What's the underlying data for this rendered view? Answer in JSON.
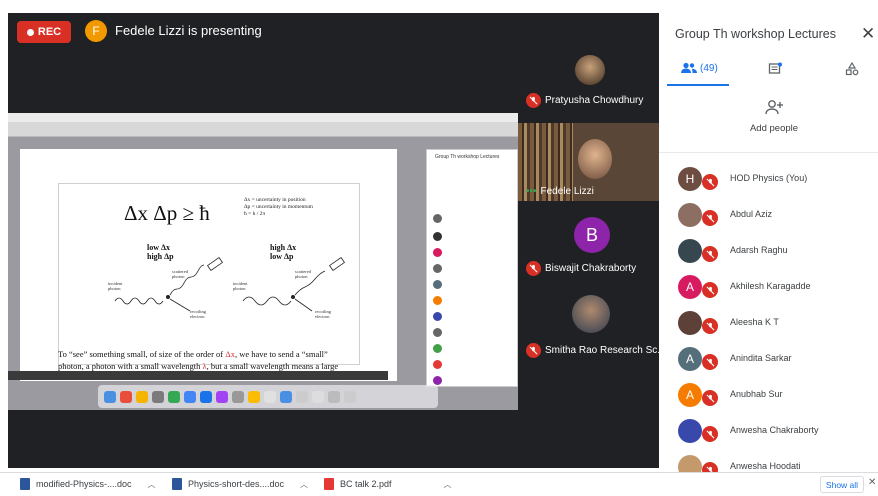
{
  "recording": {
    "label": "REC"
  },
  "presenter": {
    "initial": "F",
    "text": "Fedele Lizzi is presenting"
  },
  "slide": {
    "formula": "Δx Δp  ≥  ħ",
    "defs": [
      "Δx = uncertainty in position",
      "Δp = uncertainty in momentum",
      "ħ = h / 2π"
    ],
    "left_label": [
      "low Δx",
      "high Δp"
    ],
    "right_label": [
      "high Δx",
      "low Δp"
    ],
    "incident_photon": [
      "incident",
      "photon"
    ],
    "scattered_photon": [
      "scattered",
      "photon"
    ],
    "recoiling_electron": [
      "recoiling",
      "electron"
    ],
    "para_line1_a": "To “see” something small, of size of the order of ",
    "para_line1_sym": "Δx",
    "para_line1_b": ", we have to send a “small”",
    "para_line2_a": "photon, a photon with a small wavelength ",
    "para_line2_sym": "λ",
    "para_line2_b": ", but a small wavelength means a large"
  },
  "tiles": [
    {
      "name": "Pratyusha Chowdhury"
    },
    {
      "name": "Fedele Lizzi"
    },
    {
      "name": "Biswajit Chakraborty",
      "initial": "B"
    },
    {
      "name": "Smitha Rao Research Sc..."
    }
  ],
  "panel": {
    "title": "Group Th workshop Lectures",
    "people_count": "(49)",
    "add_people": "Add people",
    "participants": [
      {
        "name": "HOD Physics (You)",
        "initial": "H",
        "color": "#6d4c41"
      },
      {
        "name": "Abdul Aziz",
        "initial": "",
        "color": "#8d6e63"
      },
      {
        "name": "Adarsh Raghu",
        "initial": "",
        "color": "#37474f"
      },
      {
        "name": "Akhilesh Karagadde",
        "initial": "A",
        "color": "#d81b60"
      },
      {
        "name": "Aleesha K T",
        "initial": "",
        "color": "#5d4037"
      },
      {
        "name": "Anindita Sarkar",
        "initial": "A",
        "color": "#546e7a"
      },
      {
        "name": "Anubhab Sur",
        "initial": "A",
        "color": "#f57c00"
      },
      {
        "name": "Anwesha Chakraborty",
        "initial": "",
        "color": "#3949ab"
      },
      {
        "name": "Anwesha Hoodati",
        "initial": "",
        "color": "#c49a6c"
      }
    ]
  },
  "downloads": {
    "items": [
      {
        "name": "modified-Physics-....doc",
        "color": "#2b579a"
      },
      {
        "name": "Physics-short-des....doc",
        "color": "#2b579a"
      },
      {
        "name": "BC talk 2.pdf",
        "color": "#e53935"
      }
    ],
    "show_all": "Show all"
  },
  "colors": {
    "accent": "#1a73e8",
    "record": "#d93025",
    "stage": "#202124"
  }
}
